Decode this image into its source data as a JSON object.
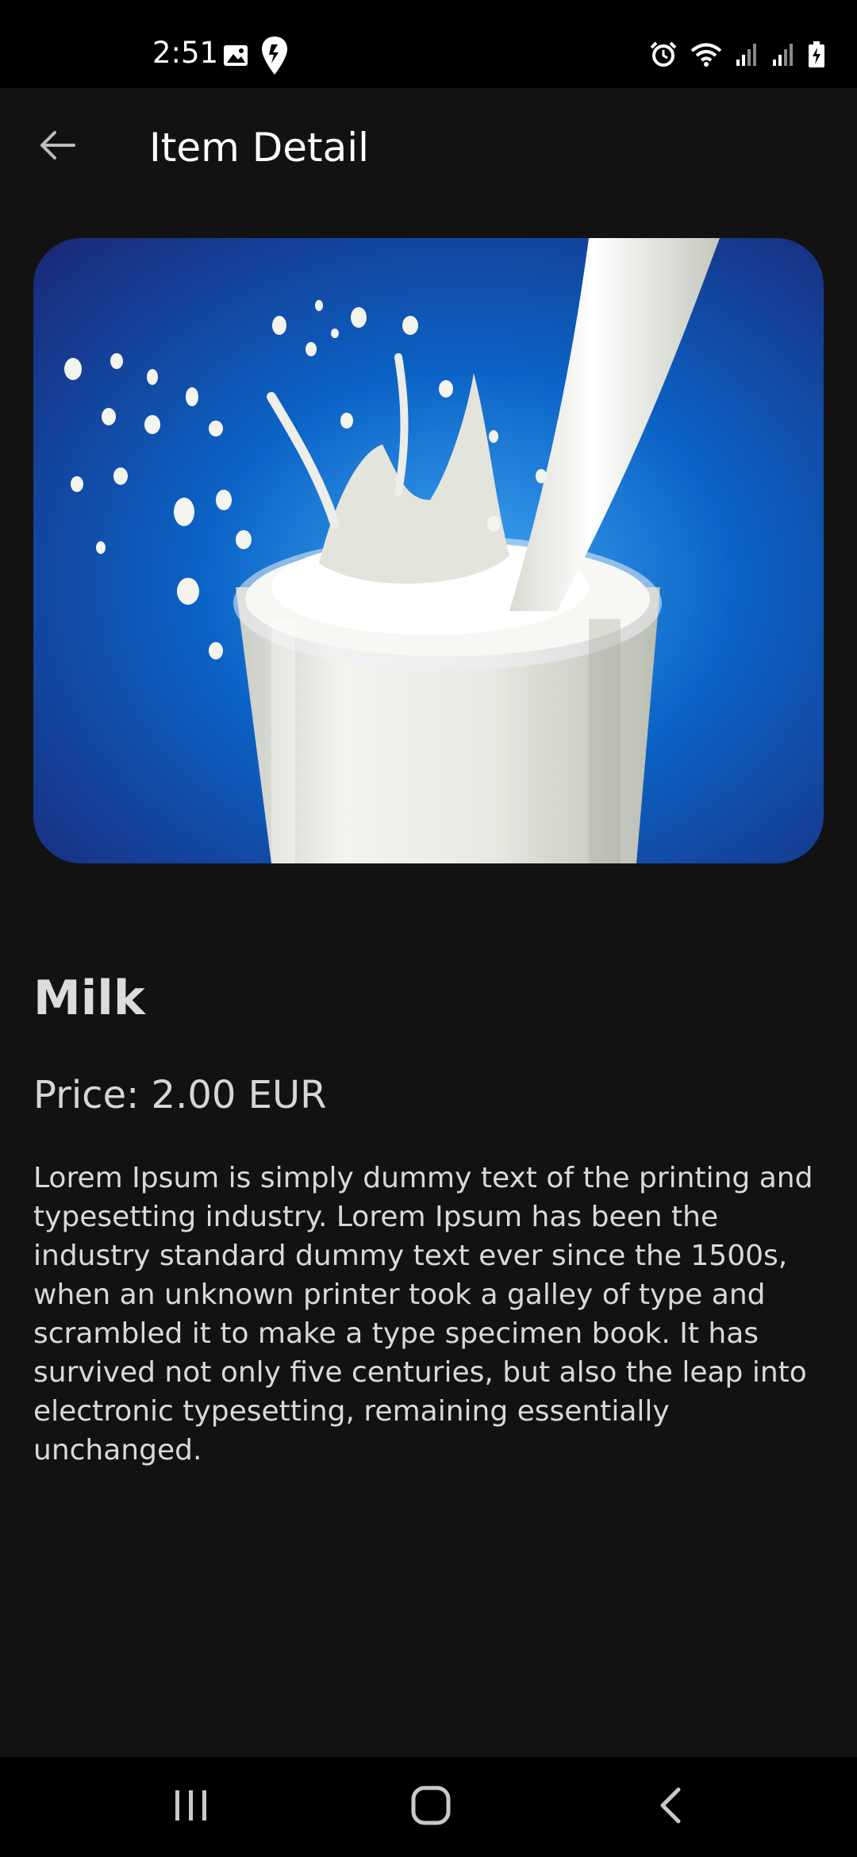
{
  "status_bar": {
    "time": "2:51",
    "left_icons": [
      "image-icon",
      "swiggy-icon"
    ],
    "right_icons": [
      "alarm-icon",
      "wifi-icon",
      "signal-icon",
      "signal-icon",
      "battery-charging-icon"
    ]
  },
  "app_bar": {
    "title": "Item Detail",
    "back_icon": "arrow-left-icon"
  },
  "item": {
    "image_description": "glass of milk with splash",
    "name": "Milk",
    "price": "Price: 2.00 EUR",
    "description": "Lorem Ipsum is simply dummy text of the printing and typesetting industry. Lorem Ipsum has been the industry standard dummy text ever since the 1500s, when an unknown printer took a galley of type and scrambled it to make a type specimen book. It has survived not only five centuries, but also the leap into electronic typesetting, remaining essentially unchanged."
  },
  "nav_bar": {
    "recents_icon": "recents-icon",
    "home_icon": "home-icon",
    "back_icon": "back-chevron-icon"
  },
  "colors": {
    "background": "#121212",
    "status_bar": "#000000",
    "image_blue": "#0b63c6"
  }
}
